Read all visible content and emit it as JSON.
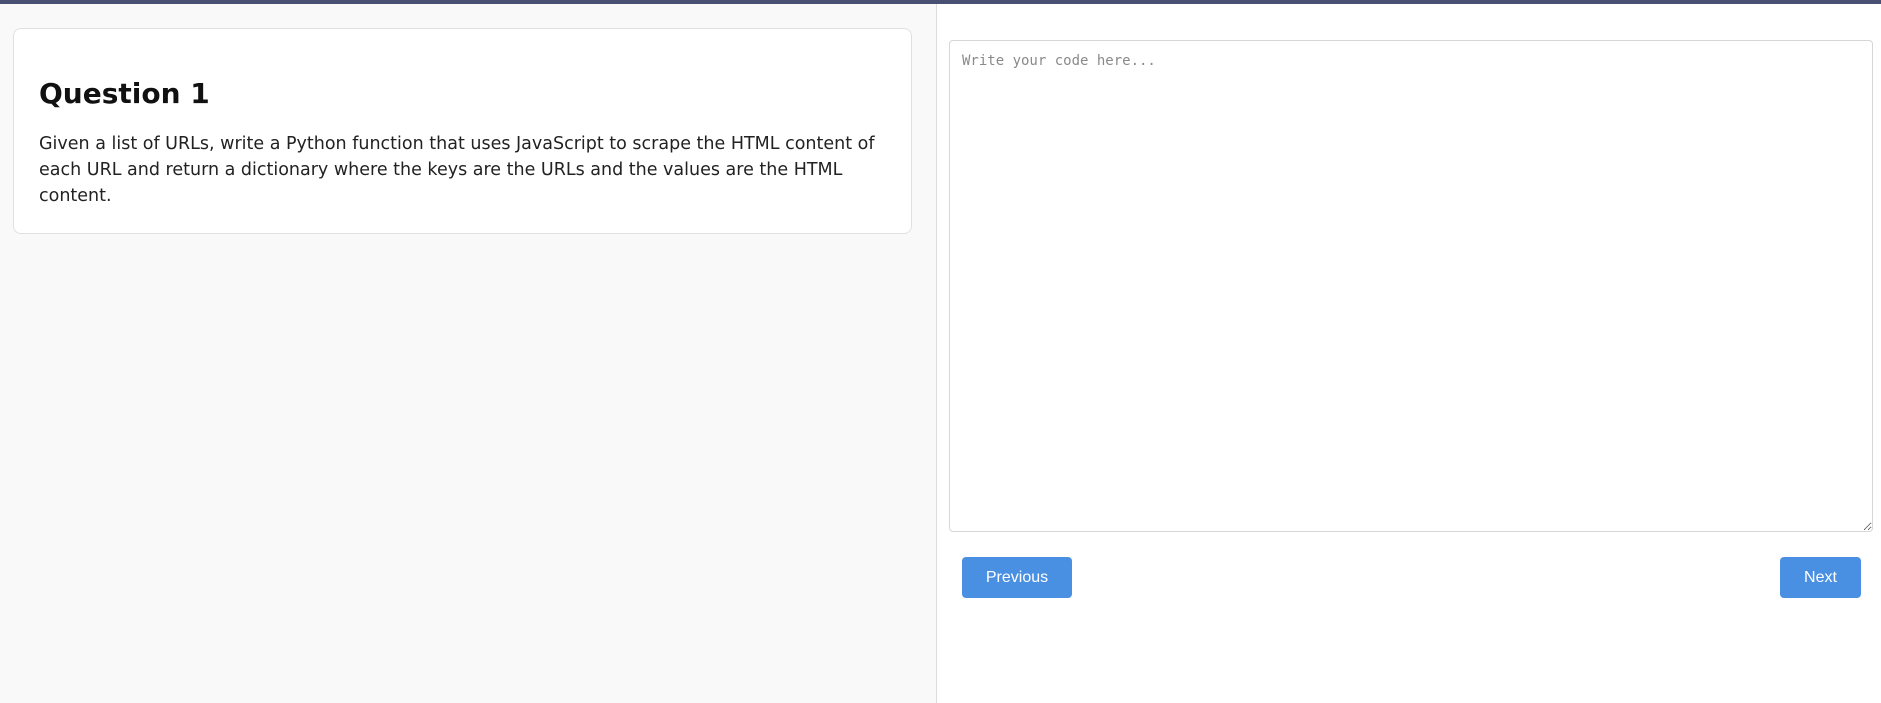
{
  "question": {
    "title": "Question 1",
    "text": "Given a list of URLs, write a Python function that uses JavaScript to scrape the HTML content of each URL and return a dictionary where the keys are the URLs and the values are the HTML content."
  },
  "editor": {
    "placeholder": "Write your code here...",
    "value": ""
  },
  "navigation": {
    "previous_label": "Previous",
    "next_label": "Next"
  },
  "colors": {
    "top_bar": "#4a4f74",
    "button": "#4a90e2",
    "background": "#f9f9f9"
  }
}
